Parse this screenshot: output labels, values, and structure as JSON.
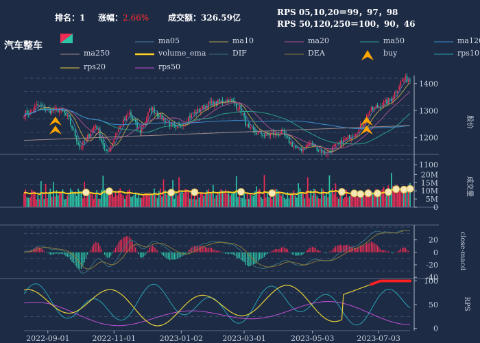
{
  "header": {
    "rank_label": "排名：",
    "rank_value": "1",
    "change_label": "涨幅：",
    "change_value": "2.66%",
    "turnover_label": "成交额：",
    "turnover_value": "326.59亿",
    "rps_short": "RPS 05,10,20＝99，97，98",
    "rps_long": "RPS 50,120,250＝100，90，46"
  },
  "sector_name": "汽车整车",
  "colors": {
    "background": "#1d2b45",
    "up": "#ef2d55",
    "down": "#2ec4a6",
    "change_value": "#ff3030",
    "volume_ema": "#ffd21f",
    "buy": "#ffa500"
  },
  "legend": [
    {
      "name": "ma05",
      "color": "#4b7aa5"
    },
    {
      "name": "ma10",
      "color": "#b5a14a"
    },
    {
      "name": "ma20",
      "color": "#a3508d"
    },
    {
      "name": "ma50",
      "color": "#2a9f8a"
    },
    {
      "name": "ma120",
      "color": "#3c8fd0"
    },
    {
      "name": "ma250",
      "color": "#9e8b8b"
    },
    {
      "name": "volume_ema",
      "color": "#ffd21f"
    },
    {
      "name": "DIF",
      "color": "#3a6f7a"
    },
    {
      "name": "DEA",
      "color": "#8a7a3a"
    },
    {
      "name": "buy",
      "color": "#ffa500"
    },
    {
      "name": "rps10",
      "color": "#2aa3b4"
    },
    {
      "name": "rps20",
      "color": "#e8d03a"
    },
    {
      "name": "rps50",
      "color": "#c24fd6"
    }
  ],
  "chart_data": {
    "type": "candlestick",
    "x_ticks": [
      "2022-09-01",
      "2022-11-01",
      "2023-01-02",
      "2023-03-01",
      "2023-05-03",
      "2023-07-03"
    ],
    "panels": [
      {
        "name": "price",
        "ylabel": "股价",
        "yticks": [
          1100,
          1200,
          1300,
          1400
        ],
        "ylim": [
          1080,
          1430
        ],
        "key_points": [
          {
            "date": "2022-08-15",
            "close": 1290
          },
          {
            "date": "2022-08-22",
            "close": 1320
          },
          {
            "date": "2022-09-01",
            "close": 1300
          },
          {
            "date": "2022-09-12",
            "close": 1305
          },
          {
            "date": "2022-09-20",
            "close": 1270
          },
          {
            "date": "2022-10-01",
            "close": 1160
          },
          {
            "date": "2022-10-15",
            "close": 1250
          },
          {
            "date": "2022-10-25",
            "close": 1140
          },
          {
            "date": "2022-11-05",
            "close": 1230
          },
          {
            "date": "2022-11-15",
            "close": 1290
          },
          {
            "date": "2022-11-25",
            "close": 1220
          },
          {
            "date": "2022-12-05",
            "close": 1310
          },
          {
            "date": "2022-12-15",
            "close": 1275
          },
          {
            "date": "2022-12-28",
            "close": 1230
          },
          {
            "date": "2023-01-10",
            "close": 1280
          },
          {
            "date": "2023-01-25",
            "close": 1320
          },
          {
            "date": "2023-02-15",
            "close": 1340
          },
          {
            "date": "2023-02-25",
            "close": 1310
          },
          {
            "date": "2023-03-05",
            "close": 1230
          },
          {
            "date": "2023-03-20",
            "close": 1210
          },
          {
            "date": "2023-04-05",
            "close": 1215
          },
          {
            "date": "2023-04-20",
            "close": 1150
          },
          {
            "date": "2023-05-01",
            "close": 1180
          },
          {
            "date": "2023-05-15",
            "close": 1140
          },
          {
            "date": "2023-05-25",
            "close": 1170
          },
          {
            "date": "2023-06-05",
            "close": 1200
          },
          {
            "date": "2023-06-15",
            "close": 1230
          },
          {
            "date": "2023-06-25",
            "close": 1300
          },
          {
            "date": "2023-07-05",
            "close": 1320
          },
          {
            "date": "2023-07-15",
            "close": 1345
          },
          {
            "date": "2023-07-25",
            "close": 1415
          }
        ],
        "buy_signals": [
          "2022-09-08",
          "2023-06-22"
        ]
      },
      {
        "name": "volume",
        "ylabel": "成交量",
        "yticks": [
          "0",
          "5M",
          "10M",
          "15M",
          "20M"
        ],
        "ylim": [
          0,
          21000000
        ]
      },
      {
        "name": "macd",
        "ylabel": "close-macd",
        "yticks": [
          -40,
          -20,
          0,
          20
        ],
        "ylim": [
          -42,
          35
        ]
      },
      {
        "name": "rps",
        "ylabel": "RPS",
        "yticks": [
          0,
          50,
          100
        ],
        "ylim": [
          -2,
          105
        ]
      }
    ]
  }
}
